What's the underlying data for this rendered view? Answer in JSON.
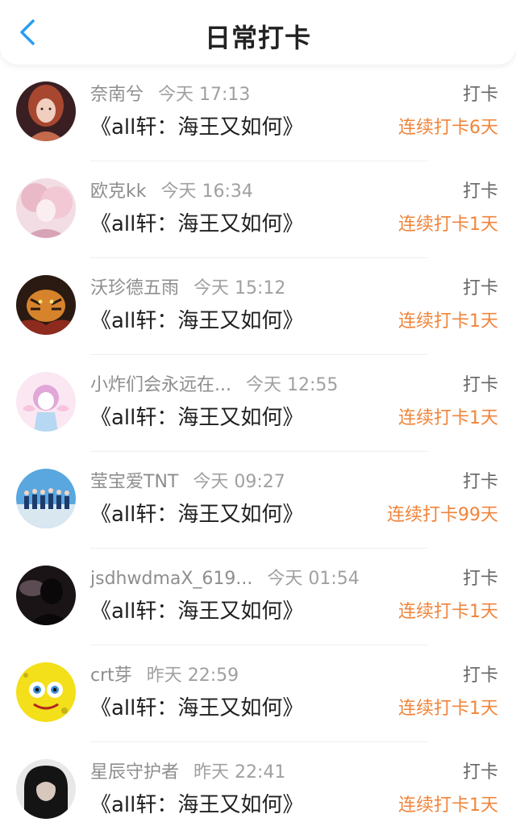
{
  "header": {
    "title": "日常打卡",
    "back_icon": "chevron-left-icon",
    "accent_color": "#2a9df4"
  },
  "streak_color": "#f0843a",
  "entries": [
    {
      "name": "奈南兮",
      "time": "今天 17:13",
      "book": "《all轩：海王又如何》",
      "checkin": "打卡",
      "streak": "连续打卡6天",
      "avatar": "avatar-red-hair-girl"
    },
    {
      "name": "欧克kk",
      "time": "今天 16:34",
      "book": "《all轩：海王又如何》",
      "checkin": "打卡",
      "streak": "连续打卡1天",
      "avatar": "avatar-pink-anime"
    },
    {
      "name": "沃珍德五雨",
      "time": "今天 15:12",
      "book": "《all轩：海王又如何》",
      "checkin": "打卡",
      "streak": "连续打卡1天",
      "avatar": "avatar-tiger"
    },
    {
      "name": "小炸们会永远在...",
      "time": "今天 12:55",
      "book": "《all轩：海王又如何》",
      "checkin": "打卡",
      "streak": "连续打卡1天",
      "avatar": "avatar-cute-girl"
    },
    {
      "name": "莹宝爱TNT",
      "time": "今天 09:27",
      "book": "《all轩：海王又如何》",
      "checkin": "打卡",
      "streak": "连续打卡99天",
      "avatar": "avatar-group-sky"
    },
    {
      "name": "jsdhwdmaX_619...",
      "time": "今天 01:54",
      "book": "《all轩：海王又如何》",
      "checkin": "打卡",
      "streak": "连续打卡1天",
      "avatar": "avatar-dark-silhouette"
    },
    {
      "name": "crt芽",
      "time": "昨天 22:59",
      "book": "《all轩：海王又如何》",
      "checkin": "打卡",
      "streak": "连续打卡1天",
      "avatar": "avatar-sponge"
    },
    {
      "name": "星辰守护者",
      "time": "昨天 22:41",
      "book": "《all轩：海王又如何》",
      "checkin": "打卡",
      "streak": "连续打卡1天",
      "avatar": "avatar-hooded-person"
    }
  ]
}
